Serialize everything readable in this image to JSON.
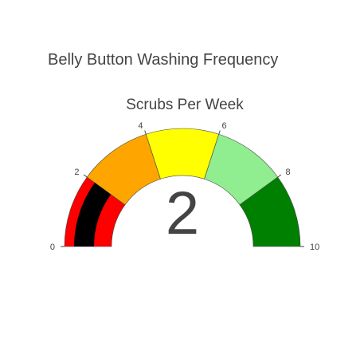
{
  "chart_data": {
    "type": "gauge",
    "title": "Belly Button Washing Frequency",
    "subtitle": "Scrubs Per Week",
    "value": 2,
    "range": [
      0,
      10
    ],
    "ticks": [
      0,
      2,
      4,
      6,
      8,
      10
    ],
    "tick_labels": [
      "0",
      "2",
      "4",
      "6",
      "8",
      "10"
    ],
    "steps": [
      {
        "range": [
          0,
          2
        ],
        "color": "#ff0000"
      },
      {
        "range": [
          2,
          4
        ],
        "color": "#ffa500"
      },
      {
        "range": [
          4,
          6
        ],
        "color": "#ffff00"
      },
      {
        "range": [
          6,
          8
        ],
        "color": "#90ee90"
      },
      {
        "range": [
          8,
          10
        ],
        "color": "#008000"
      }
    ],
    "bar_color": "#000000",
    "grid": false
  }
}
